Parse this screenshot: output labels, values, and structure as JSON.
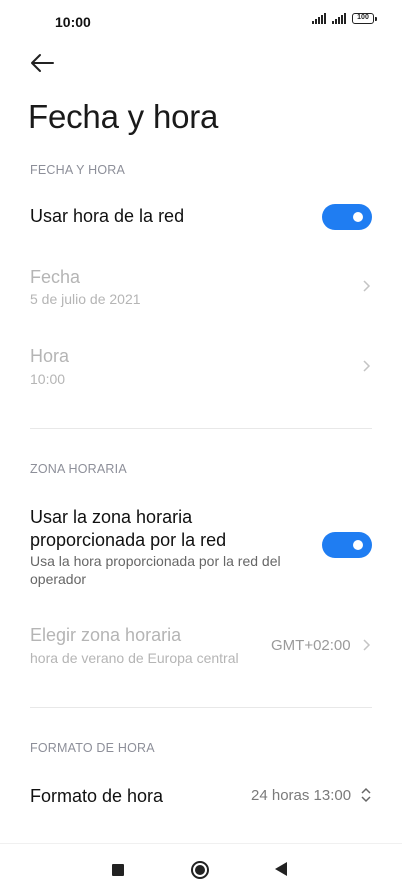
{
  "status_bar": {
    "time": "10:00",
    "battery": "100",
    "icons": [
      "signal-icon",
      "signal-icon",
      "battery-icon"
    ]
  },
  "header": {
    "back_icon": "arrow-left-icon",
    "title": "Fecha y hora"
  },
  "section_date_time": {
    "header": "FECHA Y HORA",
    "network_time": {
      "label": "Usar hora de la red",
      "enabled": true
    },
    "date": {
      "label": "Fecha",
      "value": "5 de julio de 2021"
    },
    "time": {
      "label": "Hora",
      "value": "10:00"
    }
  },
  "section_timezone": {
    "header": "ZONA HORARIA",
    "network_zone": {
      "label_line1": "Usar la zona horaria",
      "label_line2": "proporcionada por la red",
      "sub_line1": "Usa la hora proporcionada por la red del",
      "sub_line2": "operador",
      "enabled": true
    },
    "choose_zone": {
      "label": "Elegir zona horaria",
      "sub": "hora de verano de Europa central",
      "value": "GMT+02:00"
    }
  },
  "section_format": {
    "header": "FORMATO DE HORA",
    "time_format": {
      "label": "Formato de hora",
      "value": "24 horas 13:00"
    }
  },
  "nav_bar": {
    "icons": [
      "recents-square-icon",
      "home-circle-icon",
      "back-triangle-icon"
    ]
  },
  "colors": {
    "accent": "#1f7df2",
    "section_header": "#8d8f99",
    "disabled_text": "#b5b5b5"
  }
}
